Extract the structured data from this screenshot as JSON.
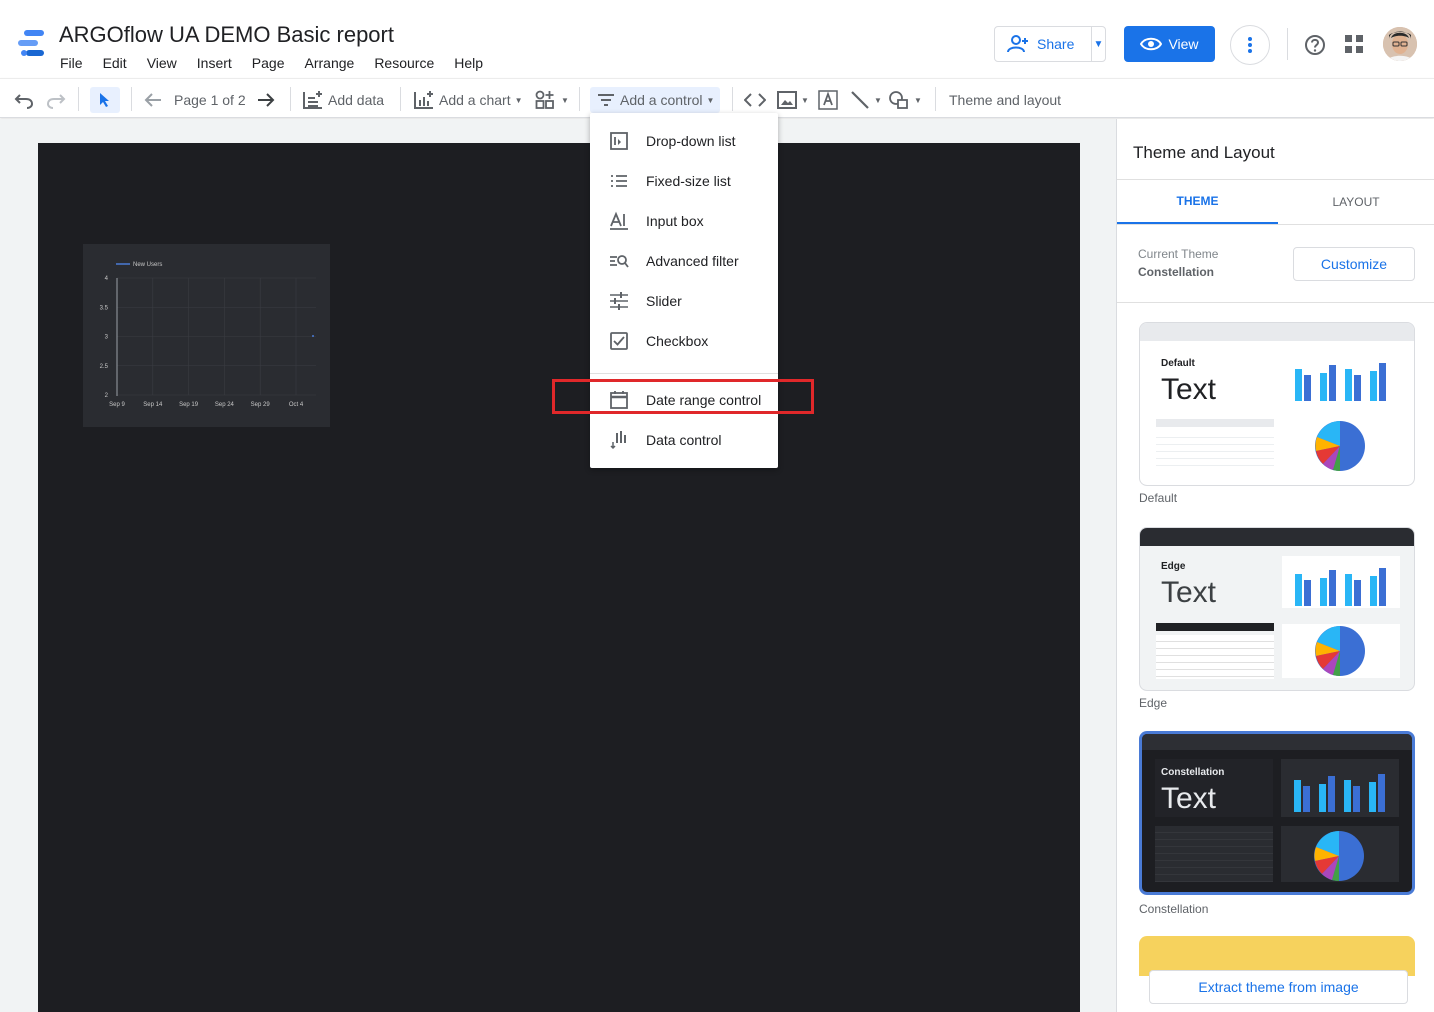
{
  "header": {
    "title": "ARGOflow UA DEMO Basic report",
    "menu": [
      "File",
      "Edit",
      "View",
      "Insert",
      "Page",
      "Arrange",
      "Resource",
      "Help"
    ],
    "share_label": "Share",
    "view_label": "View"
  },
  "toolbar": {
    "page_label": "Page 1 of 2",
    "add_data": "Add data",
    "add_chart": "Add a chart",
    "add_control": "Add a control",
    "theme_layout": "Theme and layout"
  },
  "chart": {
    "legend": "New Users",
    "y_ticks": [
      "4",
      "3.5",
      "3",
      "2.5",
      "2"
    ],
    "x_ticks": [
      "Sep 9",
      "Sep 14",
      "Sep 19",
      "Sep 24",
      "Sep 29",
      "Oct 4"
    ]
  },
  "control_menu": {
    "items": [
      "Drop-down list",
      "Fixed-size list",
      "Input box",
      "Advanced filter",
      "Slider",
      "Checkbox",
      "Date range control",
      "Data control"
    ],
    "highlighted": "Date range control"
  },
  "panel": {
    "title": "Theme and Layout",
    "tabs": [
      "THEME",
      "LAYOUT"
    ],
    "current_theme_label": "Current Theme",
    "current_theme_name": "Constellation",
    "customize": "Customize",
    "themes": [
      {
        "name": "Default",
        "card_label": "Default",
        "sample_text": "Text"
      },
      {
        "name": "Edge",
        "card_label": "Edge",
        "sample_text": "Text"
      },
      {
        "name": "Constellation",
        "card_label": "Constellation",
        "sample_text": "Text"
      }
    ],
    "extract": "Extract theme from image"
  },
  "colors": {
    "accent": "#1a73e8",
    "canvas_dark": "#1d1e22",
    "highlight_red": "#e0282a"
  }
}
